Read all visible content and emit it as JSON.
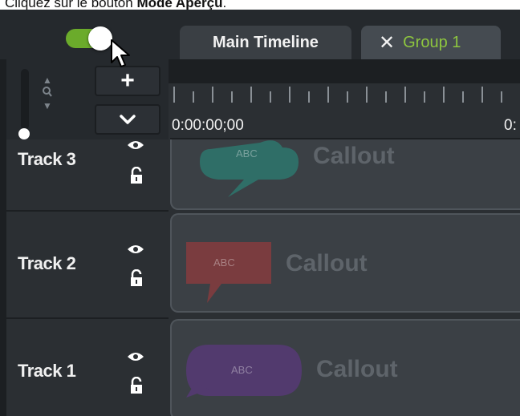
{
  "caption": {
    "prefix": "Cliquez sur le bouton ",
    "bold": "Mode Aperçu",
    "suffix": "."
  },
  "header": {
    "preview_toggle": {
      "state": "on",
      "accent": "#6bab2b"
    },
    "tabs": [
      {
        "label": "Main Timeline",
        "active": false
      },
      {
        "label": "Group 1",
        "active": true,
        "close_icon": "close-icon",
        "color": "#8ec63f"
      }
    ]
  },
  "controls": {
    "add_track_label": "+",
    "collapse_icon": "chevron-down-icon",
    "zoom_icons": [
      "arrow-up-icon",
      "zoom-icon",
      "arrow-down-icon"
    ]
  },
  "ruler": {
    "start_time": "0:00:00;00",
    "next_time": "0:"
  },
  "tracks": [
    {
      "name": "Track 3",
      "clip": {
        "label": "Callout",
        "shape_text": "ABC",
        "shape": "cloud",
        "color": "#2f6e67"
      }
    },
    {
      "name": "Track 2",
      "clip": {
        "label": "Callout",
        "shape_text": "ABC",
        "shape": "rectangle-speech",
        "color": "#7a3c3f"
      }
    },
    {
      "name": "Track 1",
      "clip": {
        "label": "Callout",
        "shape_text": "ABC",
        "shape": "oval",
        "color": "#523a6e"
      }
    }
  ]
}
